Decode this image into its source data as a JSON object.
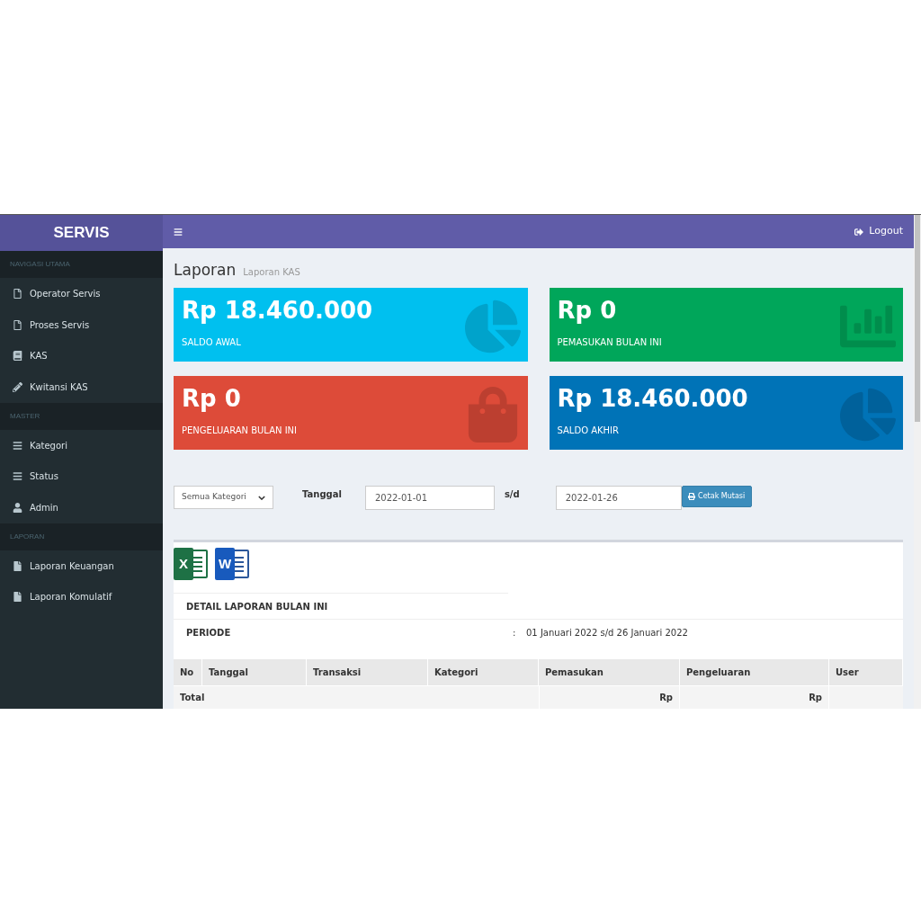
{
  "brand": "SERVIS",
  "sidebar": [
    {
      "header": "NAVIGASI UTAMA",
      "items": [
        {
          "label": "Operator Servis",
          "kind": "file"
        },
        {
          "label": "Proses Servis",
          "kind": "file"
        },
        {
          "label": "KAS",
          "kind": "book"
        },
        {
          "label": "Kwitansi KAS",
          "kind": "pencil"
        }
      ]
    },
    {
      "header": "MASTER",
      "items": [
        {
          "label": "Kategori",
          "kind": "list"
        },
        {
          "label": "Status",
          "kind": "list"
        },
        {
          "label": "Admin",
          "kind": "user"
        }
      ]
    },
    {
      "header": "LAPORAN",
      "items": [
        {
          "label": "Laporan Keuangan",
          "kind": "filled-file"
        },
        {
          "label": "Laporan Komulatif",
          "kind": "filled-file"
        }
      ]
    }
  ],
  "logout": "Logout",
  "page": {
    "title": "Laporan",
    "subtitle": "Laporan KAS"
  },
  "cards": [
    {
      "value": "Rp 18.460.000",
      "label": "SALDO AWAL",
      "color": "#00c0ef",
      "kind": "pie"
    },
    {
      "value": "Rp 0",
      "label": "PEMASUKAN BULAN INI",
      "color": "#00a65a",
      "kind": "bars"
    },
    {
      "value": "Rp 0",
      "label": "PENGELUARAN BULAN INI",
      "color": "#dd4b39",
      "kind": "bag"
    },
    {
      "value": "Rp 18.460.000",
      "label": "SALDO AKHIR",
      "color": "#0073b7",
      "kind": "pie"
    }
  ],
  "filter": {
    "category": "Semua Kategori",
    "date_label": "Tanggal",
    "from": "2022-01-01",
    "separator": "s/d",
    "to": "2022-01-26",
    "button": "Cetak Mutasi"
  },
  "exports": [
    {
      "kind": "excel",
      "letter": "X"
    },
    {
      "kind": "word",
      "letter": "W"
    }
  ],
  "detail": {
    "title": "DETAIL LAPORAN BULAN INI",
    "period_label": "PERIODE",
    "colon": ":",
    "period": "01 Januari 2022 s/d 26 Januari 2022"
  },
  "table": {
    "columns": [
      "No",
      "Tanggal",
      "Transaksi",
      "Kategori",
      "Pemasukan",
      "Pengeluaran",
      "User"
    ],
    "total": {
      "label": "Total",
      "income": "Rp",
      "expense": "Rp"
    }
  }
}
